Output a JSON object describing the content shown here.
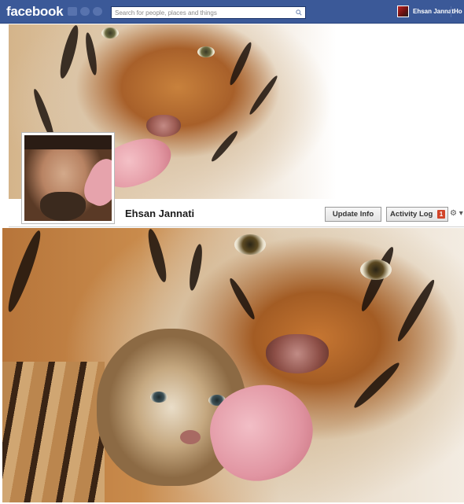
{
  "topbar": {
    "logo": "facebook",
    "search_placeholder": "Search for people, places and things",
    "user_name": "Ehsan Jannati",
    "home_label": "Ho"
  },
  "profile": {
    "name": "Ehsan Jannati",
    "update_info_label": "Update Info",
    "activity_log_label": "Activity Log",
    "activity_log_count": "1",
    "gear_label": "⚙ ▾"
  },
  "colors": {
    "brand_blue": "#3b5998",
    "badge_red": "#d2452a"
  },
  "icons": [
    "friend-requests-icon",
    "messages-icon",
    "notifications-icon",
    "search-icon",
    "gear-icon"
  ]
}
